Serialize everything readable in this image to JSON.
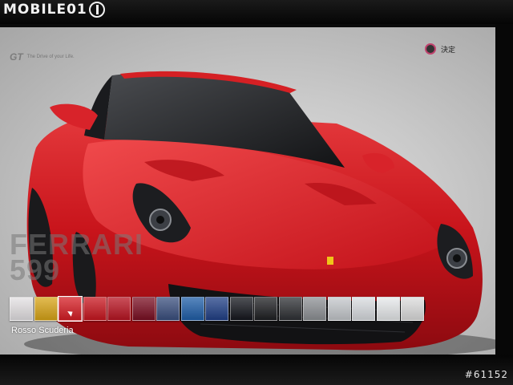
{
  "watermark": {
    "text": "MOBILE01"
  },
  "photo_id": "#61152",
  "game": {
    "logo": "GT",
    "tagline": "The Drive of your Life."
  },
  "confirm": {
    "label": "決定",
    "icon": "circle-button-icon",
    "accent": "#c0436e"
  },
  "vehicle": {
    "model_lines": [
      "FERRARI",
      "599"
    ],
    "body_color": "#cf1b22"
  },
  "palette": {
    "selected_index": 2,
    "selected_name": "Rosso Scuderia",
    "swatches": [
      "#e4e1e3",
      "#d8a417",
      "#d51d24",
      "#c8161f",
      "#b81422",
      "#7a0e22",
      "#3a4f7e",
      "#1f5ea8",
      "#203f86",
      "#14161d",
      "#1e1f22",
      "#2e3034",
      "#8d9094",
      "#c4c7cb",
      "#d8dbdf",
      "#e6e8ea",
      "#dcdcdc"
    ]
  }
}
